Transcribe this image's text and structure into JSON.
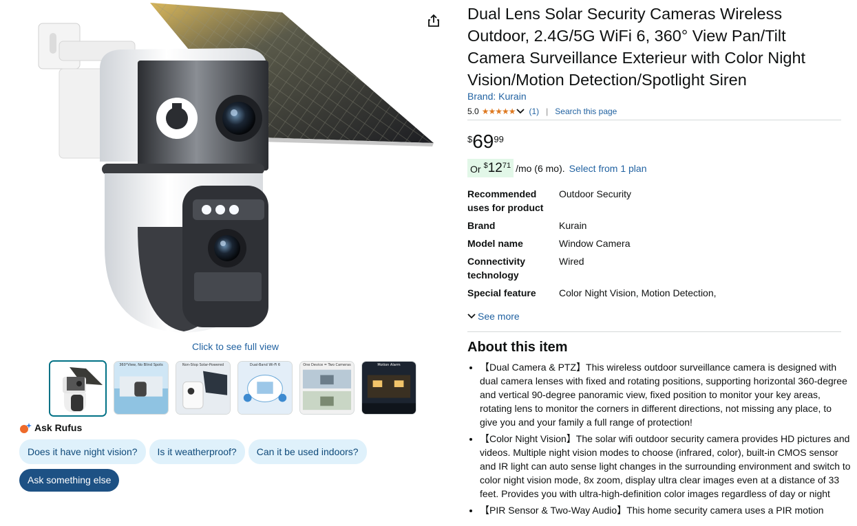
{
  "left": {
    "share_icon": "share-icon",
    "full_view_text": "Click to see full view",
    "thumbnails": [
      {
        "caption": ""
      },
      {
        "caption": "360°View, No Blind Spots"
      },
      {
        "caption": "Non-Stop Solar-Powered"
      },
      {
        "caption": "Dual-Band Wi-Fi 6"
      },
      {
        "caption": "One Device = Two Cameras"
      },
      {
        "caption": "Motion Alarm"
      }
    ],
    "rufus": {
      "title": "Ask Rufus",
      "chips": [
        "Does it have night vision?",
        "Is it weatherproof?",
        "Can it be used indoors?"
      ],
      "ask_else": "Ask something else"
    }
  },
  "product": {
    "title": "Dual Lens Solar Security Cameras Wireless Outdoor, 2.4G/5G WiFi 6, 360° View Pan/Tilt Camera Surveillance Exterieur with Color Night Vision/Motion Detection/Spotlight Siren",
    "brand_link": "Brand: Kurain",
    "rating_value": "5.0",
    "stars": "★★★★★",
    "rating_count": "(1)",
    "search_page": "Search this page",
    "price": {
      "symbol": "$",
      "whole": "69",
      "fraction": "99"
    },
    "monthly": {
      "or": "Or",
      "symbol": "$",
      "whole": "12",
      "fraction": "71",
      "per_month": "/mo (6 mo).",
      "plan_link": "Select from 1 plan"
    },
    "specs": [
      {
        "key": "Recommended uses for product",
        "value": "Outdoor Security"
      },
      {
        "key": "Brand",
        "value": "Kurain"
      },
      {
        "key": "Model name",
        "value": "Window Camera"
      },
      {
        "key": "Connectivity technology",
        "value": "Wired"
      },
      {
        "key": "Special feature",
        "value": "Color Night Vision, Motion Detection,"
      }
    ],
    "see_more": "See more",
    "about_title": "About this item",
    "bullets": [
      "【Dual Camera & PTZ】This wireless outdoor surveillance camera is designed with dual camera lenses with fixed and rotating positions, supporting horizontal 360-degree and vertical 90-degree panoramic view, fixed position to monitor your key areas, rotating lens to monitor the corners in different directions, not missing any place, to give you and your family a full range of protection!",
      "【Color Night Vision】The solar wifi outdoor security camera provides HD pictures and videos. Multiple night vision modes to choose (infrared, color), built-in CMOS sensor and IR light can auto sense light changes in the surrounding environment and switch to color night vision mode, 8x zoom, display ultra clear images even at a distance of 33 feet. Provides you with ultra-high-definition color images regardless of day or night",
      "【PIR Sensor & Two-Way Audio】This home security camera uses a PIR motion"
    ]
  }
}
